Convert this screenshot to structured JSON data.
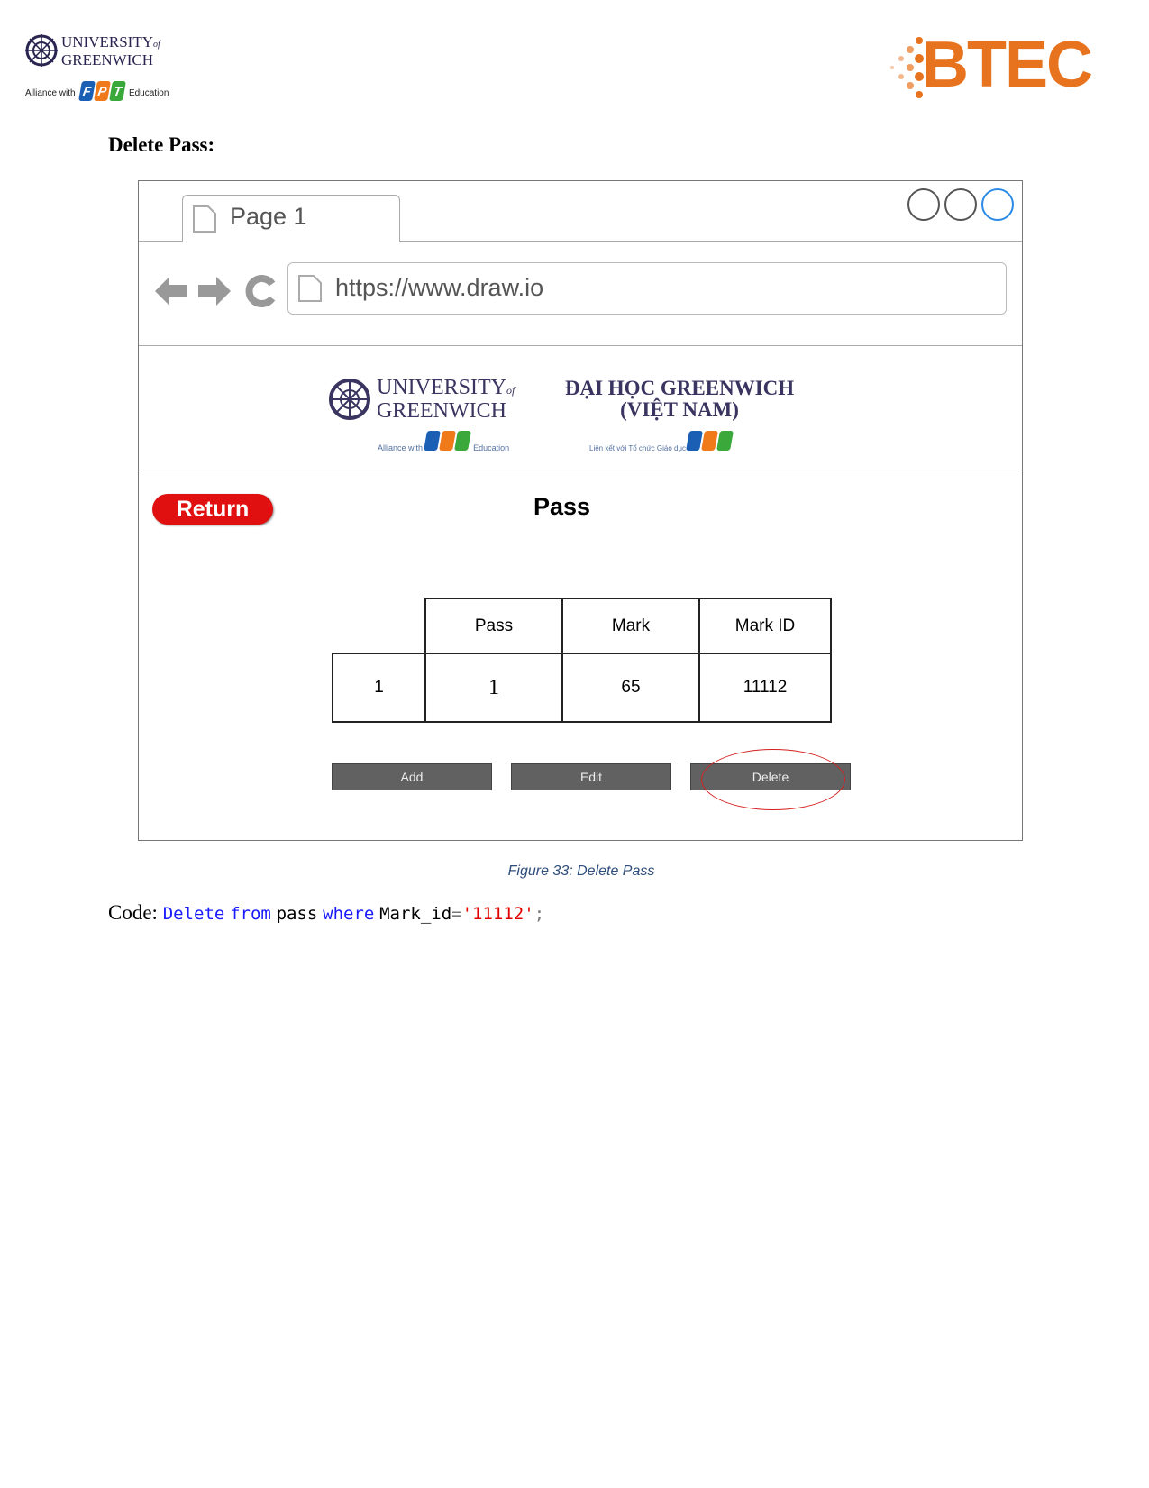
{
  "header": {
    "left_logo": {
      "line1": "UNIVERSITY",
      "of": "of",
      "line2": "GREENWICH",
      "alliance": "Alliance with",
      "fpt": [
        "F",
        "P",
        "T"
      ],
      "education": "Education"
    },
    "right_logo": "BTEC"
  },
  "section_title": "Delete Pass:",
  "mockup": {
    "tab_label": "Page 1",
    "url": "https://www.draw.io",
    "banner": {
      "uog_line1": "UNIVERSITY",
      "uog_of": "of",
      "uog_line2": "GREENWICH",
      "alliance": "Alliance with",
      "education": "Education",
      "vn_line1": "ĐẠI HỌC GREENWICH",
      "vn_line2": "(VIỆT NAM)",
      "vn_alliance": "Liên kết với Tổ chức Giáo dục"
    },
    "return_label": "Return",
    "page_title": "Pass",
    "table": {
      "headers": [
        "",
        "Pass",
        "Mark",
        "Mark ID"
      ],
      "rows": [
        [
          "1",
          "1",
          "65",
          "11112"
        ]
      ]
    },
    "buttons": {
      "add": "Add",
      "edit": "Edit",
      "delete": "Delete"
    },
    "highlight_color": "#d42020"
  },
  "caption": "Figure 33: Delete Pass",
  "code": {
    "label": "Code:",
    "kw1": "Delete",
    "kw2": "from",
    "table": "pass",
    "kw3": "where",
    "col": "Mark_id",
    "eq": "=",
    "value": "'11112'",
    "semi": ";"
  },
  "colors": {
    "keyword": "#1a1aff",
    "string": "#e00000",
    "caption": "#2e4d7b",
    "btec": "#e8731e",
    "return": "#e01010"
  }
}
